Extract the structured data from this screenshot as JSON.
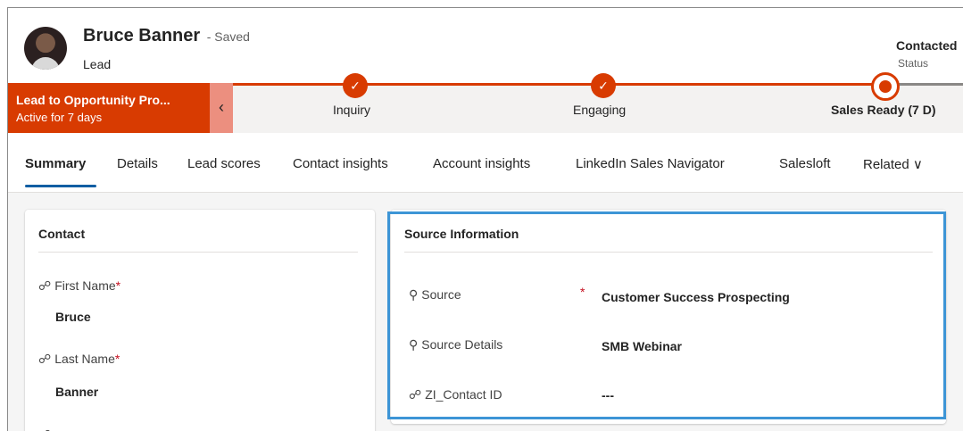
{
  "header": {
    "name": "Bruce Banner",
    "saved": "- Saved",
    "entity": "Lead",
    "status_value": "Contacted",
    "status_label": "Status"
  },
  "bpf": {
    "title": "Lead to Opportunity Pro...",
    "subtitle": "Active for 7 days",
    "collapse_icon": "chevron-left-icon",
    "stages": [
      {
        "label": "Inquiry",
        "state": "completed"
      },
      {
        "label": "Engaging",
        "state": "completed"
      },
      {
        "label": "Sales Ready (7 D)",
        "state": "active"
      }
    ]
  },
  "tabs": [
    {
      "label": "Summary",
      "active": true
    },
    {
      "label": "Details"
    },
    {
      "label": "Lead scores"
    },
    {
      "label": "Contact insights"
    },
    {
      "label": "Account insights"
    },
    {
      "label": "LinkedIn Sales Navigator"
    },
    {
      "label": "Salesloft"
    },
    {
      "label": "Related ∨"
    }
  ],
  "contact": {
    "title": "Contact",
    "fields": [
      {
        "label": "First Name",
        "required": "*",
        "value": "Bruce",
        "icon": "lock-icon"
      },
      {
        "label": "Last Name",
        "required": "*",
        "value": "Banner",
        "icon": "lock-icon"
      }
    ]
  },
  "source": {
    "title": "Source Information",
    "fields": [
      {
        "label": "Source",
        "required": "*",
        "value": "Customer Success Prospecting",
        "icon": "key-icon"
      },
      {
        "label": "Source Details",
        "value": "SMB Webinar",
        "icon": "key-icon"
      },
      {
        "label": "ZI_Contact ID",
        "value": "---",
        "icon": "lock-icon"
      }
    ]
  },
  "colors": {
    "accent": "#d83b01",
    "tab_underline": "#115ea3",
    "highlight": "#3d95d6"
  }
}
